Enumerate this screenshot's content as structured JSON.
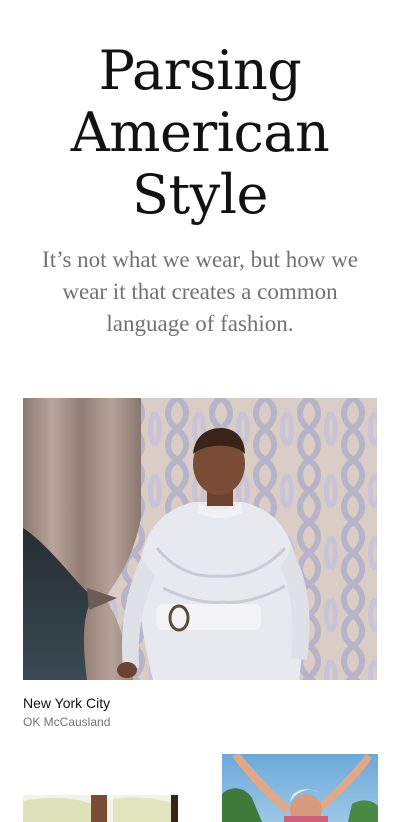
{
  "article": {
    "headline_lines": [
      "Parsing",
      "American",
      "Style"
    ],
    "dek": "It’s not what we wear, but how we wear it that creates a common language of fashion."
  },
  "photo": {
    "caption_title": "New York City",
    "caption_credit": "OK McCausland"
  },
  "colors": {
    "text": "#121212",
    "secondary_text": "#727272",
    "background": "#ffffff"
  }
}
